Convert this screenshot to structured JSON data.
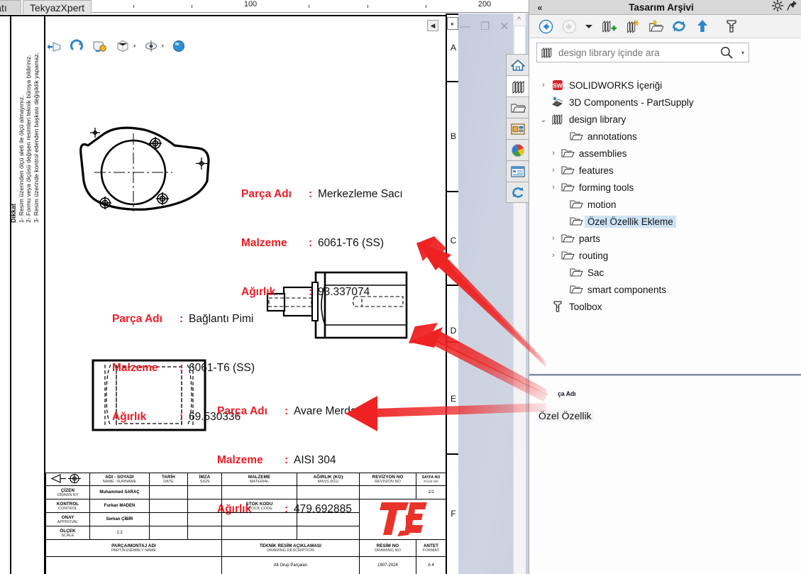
{
  "window": {
    "tabs": [
      {
        "label": "atı",
        "active": false
      },
      {
        "label": "TekyazXpert",
        "active": true
      }
    ],
    "controls": {
      "minimize": "—",
      "restore": "❐",
      "close": "✕",
      "scroll_up": "^"
    }
  },
  "ruler": {
    "labels": [
      {
        "value": "100",
        "pos": 100
      },
      {
        "value": "200",
        "pos": 200
      }
    ],
    "ticks": [
      25,
      50,
      75,
      100,
      125,
      150,
      175,
      200,
      225
    ]
  },
  "sheet": {
    "zones": [
      "A",
      "B",
      "C",
      "D",
      "E",
      "F"
    ],
    "dikkat": {
      "header": "Dikkat",
      "lines": [
        "1- Resim üzerinden ölçü aleti ile ölçü almayınız.",
        "2- Formu veya ölçüsü değişen resimleri teknik büroya bildiriniz.",
        "3- Resim üzerinde kontrol edenden başkası değişiklik yapamaz."
      ]
    },
    "collapse_icon": "◀"
  },
  "view_toolbar": {
    "icons": [
      "previous-view-icon",
      "redo-view-icon",
      "section-view-icon",
      "display-style-icon",
      "hide-show-icon",
      "appearance-icon"
    ]
  },
  "annotations": [
    {
      "id": "merkezleme-saci",
      "rows": [
        {
          "label": "Parça Adı",
          "sep": ":",
          "value": "Merkezleme Sacı"
        },
        {
          "label": "Malzeme",
          "sep": ":",
          "value": "6061-T6 (SS)"
        },
        {
          "label": "Ağırlık",
          "sep": ":",
          "value": "93.337074"
        }
      ]
    },
    {
      "id": "baglanti-pimi",
      "rows": [
        {
          "label": "Parça Adı",
          "sep": ":",
          "value": "Bağlantı Pimi"
        },
        {
          "label": "Malzeme",
          "sep": ":",
          "value": "6061-T6 (SS)"
        },
        {
          "label": "Ağırlık",
          "sep": ":",
          "value": "69.530336"
        }
      ]
    },
    {
      "id": "avare-merdane",
      "rows": [
        {
          "label": "Parça Adı",
          "sep": ":",
          "value": "Avare Merdane"
        },
        {
          "label": "Malzeme",
          "sep": ":",
          "value": "AISI 304"
        },
        {
          "label": "Ağırlık",
          "sep": ":",
          "value": "479.692885"
        }
      ]
    }
  ],
  "title_block": {
    "headers": {
      "name_tr": "ADI - SOYADI",
      "name_en": "NAME -SURNAME",
      "date_tr": "TARİH",
      "date_en": "DATE",
      "sign_tr": "İMZA",
      "sign_en": "SIGN",
      "material_tr": "MALZEME",
      "material_en": "MATERIAL",
      "mass_tr": "AĞIRLIK (KG)",
      "mass_en": "MASS (KG)",
      "revision_tr": "REVİZYON NO",
      "revision_en": "REVISION NO",
      "page_tr": "SAYFA NO",
      "page_en": "PAGE NR",
      "stock_tr": "STOK KODU",
      "stock_en": "STOCK CODE",
      "partname_tr": "PARÇA/MONTAJ ADI",
      "partname_en": "PART/ASSEMBLY NAME",
      "desc_tr": "TEKNİK RESİM AÇIKLAMASI",
      "desc_en": "DRAWING DESCRIPTION",
      "drawingno_tr": "RESİM NO",
      "drawingno_en": "DRAWING NO",
      "format_tr": "ANTET",
      "format_en": "FORMAT"
    },
    "rows": [
      {
        "role_tr": "ÇİZEN",
        "role_en": "DRAWN BY",
        "person": "Muhammed SARAÇ"
      },
      {
        "role_tr": "KONTROL",
        "role_en": "CONTROL",
        "person": "Furkan MADEN"
      },
      {
        "role_tr": "ONAY",
        "role_en": "APPROVAL",
        "person": "Serkan ÇİBİR"
      },
      {
        "role_tr": "ÖLÇEK",
        "role_en": "SCALE",
        "person": "1:2"
      }
    ],
    "page_value": "1/1",
    "description_value": "Alt Grup Parçaları",
    "drawing_no_value": "1907-2024",
    "format_value": "A 4",
    "logo_alt": "tekyaz-logo"
  },
  "task_pane": {
    "title": "Tasarım Arşivi",
    "collapse_icon": "«",
    "gear_icon": "gear-icon",
    "pin_icon": "pin-icon",
    "toolbar": [
      "back-icon",
      "forward-icon",
      "dropdown-arrow-icon",
      "add-to-library-icon",
      "new-folder-icon",
      "open-folder-icon",
      "refresh-icon",
      "up-one-level-icon",
      "toolbox-icon"
    ],
    "search": {
      "placeholder": "design library içinde ara",
      "value": "",
      "icon": "design-library-icon",
      "magnifier": "search-icon",
      "dropdown": "chevron-down-icon"
    },
    "tree": [
      {
        "label": "SOLIDWORKS İçeriği",
        "icon": "solidworks-icon",
        "indent": 0,
        "chevron": "›",
        "selected": false
      },
      {
        "label": "3D Components - PartSupply",
        "icon": "3d-components-icon",
        "indent": 0,
        "chevron": "",
        "selected": false
      },
      {
        "label": "design library",
        "icon": "design-library-icon",
        "indent": 0,
        "chevron": "⌄",
        "selected": false
      },
      {
        "label": "annotations",
        "icon": "folder-icon",
        "indent": 1,
        "chevron": "",
        "selected": false
      },
      {
        "label": "assemblies",
        "icon": "folder-icon",
        "indent": 1,
        "chevron": "›",
        "selected": false
      },
      {
        "label": "features",
        "icon": "folder-icon",
        "indent": 1,
        "chevron": "›",
        "selected": false
      },
      {
        "label": "forming tools",
        "icon": "folder-icon",
        "indent": 1,
        "chevron": "›",
        "selected": false
      },
      {
        "label": "motion",
        "icon": "folder-icon",
        "indent": 1,
        "chevron": "",
        "selected": false
      },
      {
        "label": "Özel Özellik Ekleme",
        "icon": "folder-icon",
        "indent": 1,
        "chevron": "",
        "selected": true
      },
      {
        "label": "parts",
        "icon": "folder-icon",
        "indent": 1,
        "chevron": "›",
        "selected": false
      },
      {
        "label": "routing",
        "icon": "folder-icon",
        "indent": 1,
        "chevron": "›",
        "selected": false
      },
      {
        "label": "Sac",
        "icon": "folder-icon",
        "indent": 1,
        "chevron": "",
        "selected": false
      },
      {
        "label": "smart components",
        "icon": "folder-icon",
        "indent": 1,
        "chevron": "",
        "selected": false
      },
      {
        "label": "Toolbox",
        "icon": "toolbox-icon",
        "indent": 0,
        "chevron": "",
        "selected": false
      }
    ],
    "preview": {
      "macro_label": "ça Adı",
      "item_label": "Özel Özellik",
      "cursor_icon": "cursor-pointer-sparkle-icon"
    }
  },
  "task_strip": {
    "buttons": [
      {
        "name": "home-icon",
        "selected": false
      },
      {
        "name": "design-library-icon",
        "selected": true
      },
      {
        "name": "file-explorer-icon",
        "selected": false
      },
      {
        "name": "view-palette-icon",
        "selected": false
      },
      {
        "name": "solidworks-resources-icon",
        "selected": false
      },
      {
        "name": "appearances-scenes-icon",
        "selected": false
      },
      {
        "name": "custom-properties-icon",
        "selected": false
      }
    ]
  },
  "colors": {
    "annotation_key": "#ee1c25",
    "annotation_value": "#111111",
    "selection": "#cde4f7",
    "arrow": "#ee2222",
    "logo": "#e8332a"
  }
}
